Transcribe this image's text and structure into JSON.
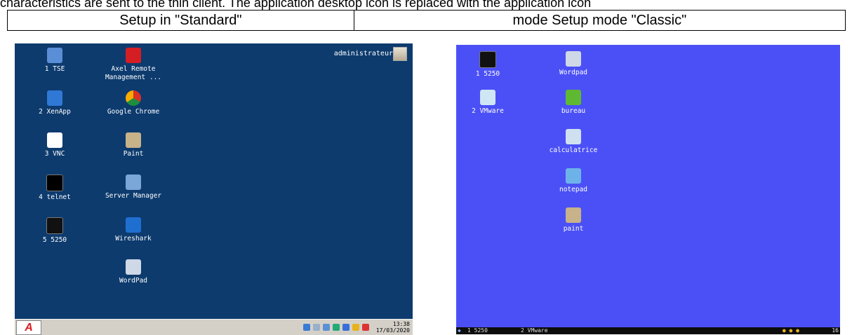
{
  "intro_text": "characteristics are sent to the thin client. The application desktop icon is replaced with the application icon",
  "table_headers": [
    "Setup in \"Standard\"",
    "mode Setup mode \"Classic\""
  ],
  "standard": {
    "user_name": "administrateur",
    "icons": [
      {
        "label": "1 TSE",
        "icon": "computer-icon",
        "color": "#5a8ed6"
      },
      {
        "label": "2 XenApp",
        "icon": "xenapp-icon",
        "color": "#2f78d6"
      },
      {
        "label": "3 VNC",
        "icon": "vnc-icon",
        "color": "#ffffff"
      },
      {
        "label": "4 telnet",
        "icon": "terminal-icon",
        "color": "#000000"
      },
      {
        "label": "5 5250",
        "icon": "5250-terminal-icon",
        "color": "#111111"
      },
      {
        "label": "Axel Remote\nManagement ...",
        "icon": "axel-remote-icon",
        "color": "#d51e24"
      },
      {
        "label": "Google Chrome",
        "icon": "chrome-icon",
        "color": "#e8a623"
      },
      {
        "label": "Paint",
        "icon": "paint-icon",
        "color": "#c7b28a"
      },
      {
        "label": "Server Manager",
        "icon": "server-icon",
        "color": "#7aa6d8"
      },
      {
        "label": "Wireshark",
        "icon": "wireshark-icon",
        "color": "#1f6fd1"
      },
      {
        "label": "WordPad",
        "icon": "wordpad-icon",
        "color": "#cfd8e6"
      }
    ],
    "taskbar": {
      "start_label": "A",
      "time": "13:38",
      "date": "17/03/2020",
      "tray_colors": [
        "#3a7bd5",
        "#9ab0c8",
        "#5b8fd6",
        "#2a7",
        "#3b6fd8",
        "#e7b21c",
        "#d33"
      ]
    }
  },
  "classic": {
    "icons": [
      {
        "label": "1 5250",
        "icon": "5250-terminal-icon",
        "color": "#111111"
      },
      {
        "label": "2 VMware",
        "icon": "vmware-icon",
        "color": "#cfe6f5"
      },
      {
        "label": "Wordpad",
        "icon": "wordpad-icon",
        "color": "#cfd8e6"
      },
      {
        "label": "bureau",
        "icon": "folder-icon",
        "color": "#5fb832"
      },
      {
        "label": "calculatrice",
        "icon": "calculator-icon",
        "color": "#cfe0f0"
      },
      {
        "label": "notepad",
        "icon": "notepad-icon",
        "color": "#6db3ea"
      },
      {
        "label": "paint",
        "icon": "paint-icon",
        "color": "#c7b28a"
      }
    ],
    "taskbar": {
      "item1": "1 5250",
      "item2": "2 VMware",
      "clock_fragment": "16"
    }
  }
}
